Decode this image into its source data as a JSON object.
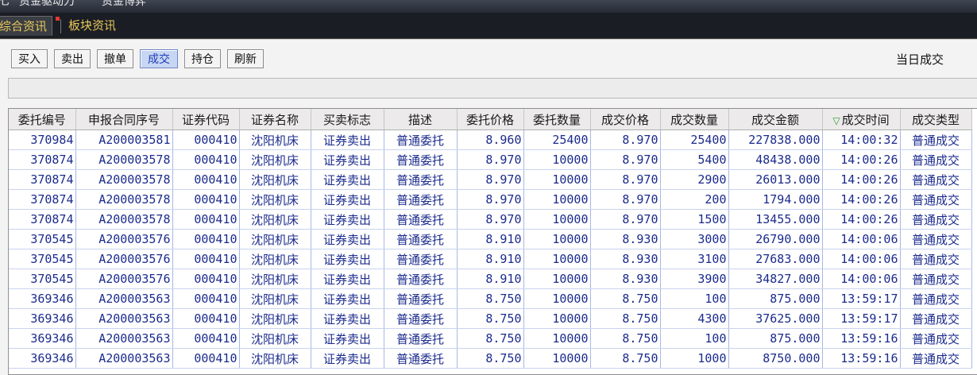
{
  "topbar": {
    "items": [
      "七",
      "资金驱动力",
      "资金博弈"
    ]
  },
  "tabs": [
    {
      "label": "综合资讯"
    },
    {
      "label": "板块资讯"
    }
  ],
  "toolbar": {
    "buttons": [
      "买入",
      "卖出",
      "撤单",
      "成交",
      "持仓",
      "刷新"
    ],
    "active": "成交"
  },
  "page_title": "当日成交",
  "table": {
    "headers": [
      "委托编号",
      "申报合同序号",
      "证券代码",
      "证券名称",
      "买卖标志",
      "描述",
      "委托价格",
      "委托数量",
      "成交价格",
      "成交数量",
      "成交金额",
      "成交时间",
      "成交类型"
    ],
    "sorted_column": "成交时间",
    "rows": [
      [
        "370984",
        "A200003581",
        "000410",
        "沈阳机床",
        "证券卖出",
        "普通委托",
        "8.960",
        "25400",
        "8.970",
        "25400",
        "227838.000",
        "14:00:32",
        "普通成交"
      ],
      [
        "370874",
        "A200003578",
        "000410",
        "沈阳机床",
        "证券卖出",
        "普通委托",
        "8.970",
        "10000",
        "8.970",
        "5400",
        "48438.000",
        "14:00:26",
        "普通成交"
      ],
      [
        "370874",
        "A200003578",
        "000410",
        "沈阳机床",
        "证券卖出",
        "普通委托",
        "8.970",
        "10000",
        "8.970",
        "2900",
        "26013.000",
        "14:00:26",
        "普通成交"
      ],
      [
        "370874",
        "A200003578",
        "000410",
        "沈阳机床",
        "证券卖出",
        "普通委托",
        "8.970",
        "10000",
        "8.970",
        "200",
        "1794.000",
        "14:00:26",
        "普通成交"
      ],
      [
        "370874",
        "A200003578",
        "000410",
        "沈阳机床",
        "证券卖出",
        "普通委托",
        "8.970",
        "10000",
        "8.970",
        "1500",
        "13455.000",
        "14:00:26",
        "普通成交"
      ],
      [
        "370545",
        "A200003576",
        "000410",
        "沈阳机床",
        "证券卖出",
        "普通委托",
        "8.910",
        "10000",
        "8.930",
        "3000",
        "26790.000",
        "14:00:06",
        "普通成交"
      ],
      [
        "370545",
        "A200003576",
        "000410",
        "沈阳机床",
        "证券卖出",
        "普通委托",
        "8.910",
        "10000",
        "8.930",
        "3100",
        "27683.000",
        "14:00:06",
        "普通成交"
      ],
      [
        "370545",
        "A200003576",
        "000410",
        "沈阳机床",
        "证券卖出",
        "普通委托",
        "8.910",
        "10000",
        "8.930",
        "3900",
        "34827.000",
        "14:00:06",
        "普通成交"
      ],
      [
        "369346",
        "A200003563",
        "000410",
        "沈阳机床",
        "证券卖出",
        "普通委托",
        "8.750",
        "10000",
        "8.750",
        "100",
        "875.000",
        "13:59:17",
        "普通成交"
      ],
      [
        "369346",
        "A200003563",
        "000410",
        "沈阳机床",
        "证券卖出",
        "普通委托",
        "8.750",
        "10000",
        "8.750",
        "4300",
        "37625.000",
        "13:59:17",
        "普通成交"
      ],
      [
        "369346",
        "A200003563",
        "000410",
        "沈阳机床",
        "证券卖出",
        "普通委托",
        "8.750",
        "10000",
        "8.750",
        "100",
        "875.000",
        "13:59:16",
        "普通成交"
      ],
      [
        "369346",
        "A200003563",
        "000410",
        "沈阳机床",
        "证券卖出",
        "普通委托",
        "8.750",
        "10000",
        "8.750",
        "1000",
        "8750.000",
        "13:59:16",
        "普通成交"
      ]
    ]
  },
  "colors": {
    "cell_text": "#1b2b8c",
    "tab_text": "#e8c85a",
    "active_button": "#c7d6f2",
    "sort_arrow": "#2e9d2e"
  },
  "icons": {
    "sort": "sort-descending-icon"
  }
}
